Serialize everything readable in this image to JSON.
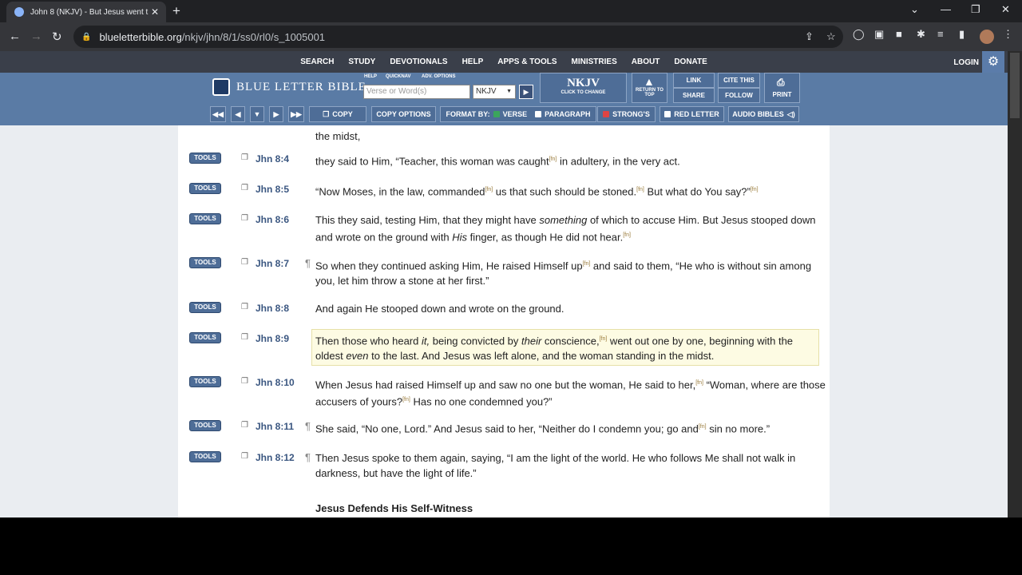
{
  "browser": {
    "tab_title": "John 8 (NKJV) - But Jesus went t",
    "url_host": "blueletterbible.org",
    "url_path": "/nkjv/jhn/8/1/ss0/rl0/s_1005001"
  },
  "topnav": [
    "SEARCH",
    "STUDY",
    "DEVOTIONALS",
    "HELP",
    "APPS & TOOLS",
    "MINISTRIES",
    "ABOUT",
    "DONATE"
  ],
  "login": "LOGIN",
  "header": {
    "logo": "BLUE LETTER BIBLE",
    "mini": {
      "help": "HELP",
      "quicknav": "QUICKNAV",
      "adv": "ADV. OPTIONS"
    },
    "search_placeholder": "Verse or Word(s)",
    "version": "NKJV",
    "version_big": "NKJV",
    "version_sub": "CLICK TO CHANGE",
    "return_top": "RETURN TO TOP",
    "link": "LINK",
    "share": "SHARE",
    "cite": "CITE THIS",
    "follow": "FOLLOW",
    "print": "PRINT"
  },
  "toolbar": {
    "copy": "COPY",
    "copy_options": "COPY OPTIONS",
    "format_by": "FORMAT BY:",
    "verse": "VERSE",
    "paragraph": "PARAGRAPH",
    "strongs": "STRONG'S",
    "red_letter": "RED LETTER",
    "audio": "AUDIO BIBLES"
  },
  "tools_label": "TOOLS",
  "prev_text": "the midst,",
  "verses": [
    {
      "ref": "Jhn 8:4",
      "para": false,
      "html": "they said to Him, “Teacher, this woman was caught<sup class=\"fn\">[fn]</sup> in adultery, in the very act."
    },
    {
      "ref": "Jhn 8:5",
      "para": false,
      "html": "“Now Moses, in the law, commanded<sup class=\"fn\">[fn]</sup> us that such should be stoned.<sup class=\"fn\">[fn]</sup> But what do You say?”<sup class=\"fn\">[fn]</sup>"
    },
    {
      "ref": "Jhn 8:6",
      "para": false,
      "html": "This they said, testing Him, that they might have <i>something</i> of which to accuse Him. But Jesus stooped down and wrote on the ground with <i>His</i> finger, as though He did not hear.<sup class=\"fn\">[fn]</sup>"
    },
    {
      "ref": "Jhn 8:7",
      "para": true,
      "html": "So when they continued asking Him, He raised Himself up<sup class=\"fn\">[fn]</sup> and said to them, “He who is without sin among you, let him throw a stone at her first.”"
    },
    {
      "ref": "Jhn 8:8",
      "para": false,
      "html": "And again He stooped down and wrote on the ground."
    },
    {
      "ref": "Jhn 8:9",
      "para": false,
      "html": "Then those who heard <i>it,</i> being convicted by <i>their</i> conscience,<sup class=\"fn\">[fn]</sup> went out one by one, beginning with the oldest <i>even</i> to the last. And Jesus was left alone, and the woman standing in the midst."
    },
    {
      "ref": "Jhn 8:10",
      "para": false,
      "html": "When Jesus had raised Himself up and saw no one but the woman, He said to her,<sup class=\"fn\">[fn]</sup> “Woman, where are those accusers of yours?<sup class=\"fn\">[fn]</sup> Has no one condemned you?”"
    },
    {
      "ref": "Jhn 8:11",
      "para": true,
      "html": "She said, “No one, Lord.” And Jesus said to her, “Neither do I condemn you; go and<sup class=\"fn\">[fn]</sup> sin no more.”"
    },
    {
      "ref": "Jhn 8:12",
      "para": true,
      "html": "Then Jesus spoke to them again, saying, “I am the light of the world. He who follows Me shall not walk in darkness, but have the light of life.”"
    }
  ],
  "section_heading": "Jesus Defends His Self-Witness"
}
